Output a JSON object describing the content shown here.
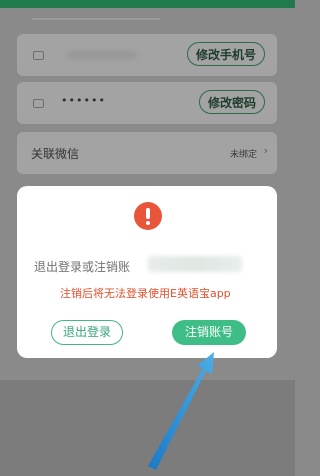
{
  "settings": {
    "phone_button": "修改手机号",
    "password_value": "••••••",
    "password_button": "修改密码",
    "wechat_label": "关联微信",
    "wechat_status": "未绑定",
    "wechat_chevron": "›"
  },
  "dialog": {
    "icon": "exclamation-icon",
    "message": "退出登录或注销账",
    "warning": "注销后将无法登录使用E英语宝app",
    "logout_button": "退出登录",
    "cancel_account_button": "注销账号"
  },
  "colors": {
    "accent": "#3ebd87",
    "warning": "#e0502c",
    "alert_icon": "#e8553b",
    "pointer_arrow": "#2f93d6"
  }
}
